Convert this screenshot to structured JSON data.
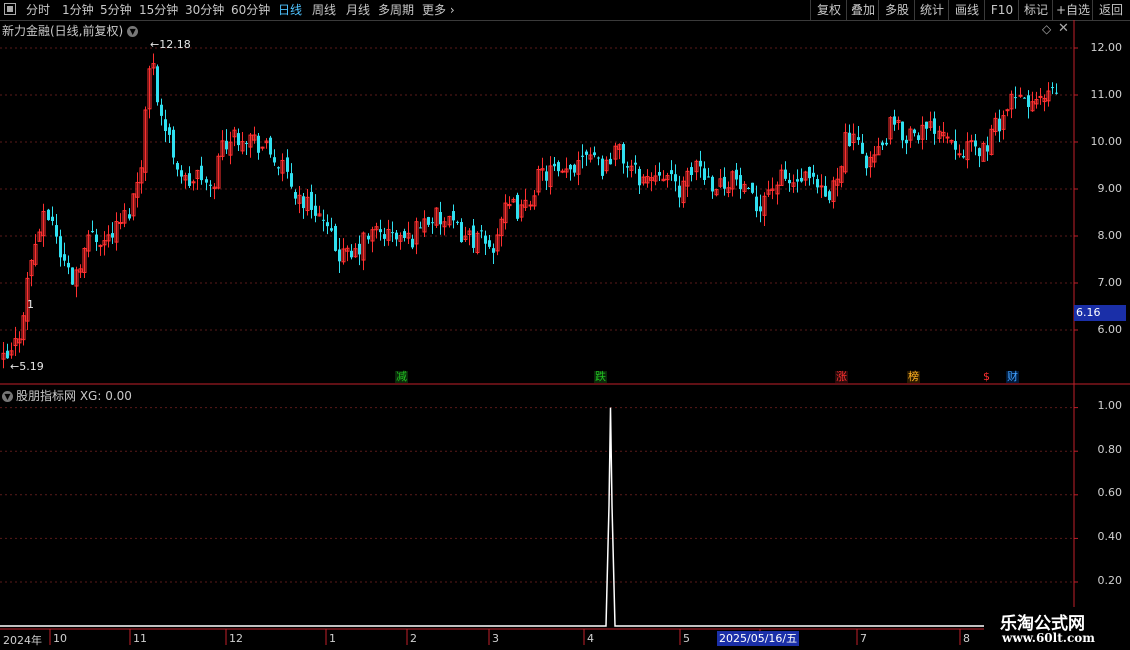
{
  "toolbar": {
    "periods": [
      "分时",
      "1分钟",
      "5分钟",
      "15分钟",
      "30分钟",
      "60分钟",
      "日线",
      "周线",
      "月线",
      "多周期",
      "更多"
    ],
    "more_arrow": "›",
    "active_period": "日线",
    "right_buttons": [
      "复权",
      "叠加",
      "多股",
      "统计",
      "画线",
      "F10",
      "标记",
      "+自选",
      "返回"
    ]
  },
  "main_chart": {
    "title": "新力金融(日线,前复权)",
    "price_ticks": [
      "12.00",
      "11.00",
      "10.00",
      "9.00",
      "8.00",
      "7.00",
      "6.00"
    ],
    "current_price_tag": "6.16",
    "high_marker": "12.18",
    "low_marker": "5.19",
    "one_marker": "1",
    "events": [
      {
        "label": "减",
        "color": "#20c020",
        "bg": "#0a2a0a"
      },
      {
        "label": "跌",
        "color": "#20c020",
        "bg": "#0a2a0a"
      },
      {
        "label": "涨",
        "color": "#ff3030",
        "bg": "#2a0a0a"
      },
      {
        "label": "榜",
        "color": "#ffb020",
        "bg": "#2a1a00"
      },
      {
        "label": "$",
        "color": "#ff3030",
        "bg": "#000000"
      },
      {
        "label": "财",
        "color": "#40a0ff",
        "bg": "#001a3a"
      }
    ],
    "diamond_icon": "diamond-icon",
    "close_icon": "close-icon"
  },
  "indicator": {
    "title": "股朋指标网 XG: 0.00",
    "ticks": [
      "1.00",
      "0.80",
      "0.60",
      "0.40",
      "0.20"
    ]
  },
  "date_axis": {
    "labels": [
      "2024年",
      "10",
      "11",
      "12",
      "1",
      "2",
      "3",
      "4",
      "5",
      "2025/05/16/五",
      "7",
      "8"
    ],
    "highlighted": "2025/05/16/五"
  },
  "watermark": {
    "line1": "乐淘公式网",
    "line2": "www.60lt.com"
  },
  "colors": {
    "up": "#ff3030",
    "down": "#30e0f0",
    "axis": "#c0202a",
    "grid": "#5a1a1a",
    "active": "#4fc3ff",
    "price_tag_bg": "#1a2fa8"
  },
  "chart_data": {
    "type": "candlestick",
    "title": "新力金融(日线,前复权)",
    "y_range": [
      5.0,
      12.4
    ],
    "y_ticks": [
      6,
      7,
      8,
      9,
      10,
      11,
      12
    ],
    "x_labels": [
      "2024年",
      "10",
      "11",
      "12",
      "1",
      "2",
      "3",
      "4",
      "5",
      "2025/05/16/五",
      "7",
      "8"
    ],
    "highest": 12.18,
    "lowest": 5.19,
    "close_tag": 6.16,
    "indicator": {
      "name": "XG",
      "value": 0.0,
      "y_range": [
        0,
        1.0
      ],
      "y_ticks": [
        0.2,
        0.4,
        0.6,
        0.8,
        1.0
      ],
      "spike_value": 1.0
    }
  }
}
